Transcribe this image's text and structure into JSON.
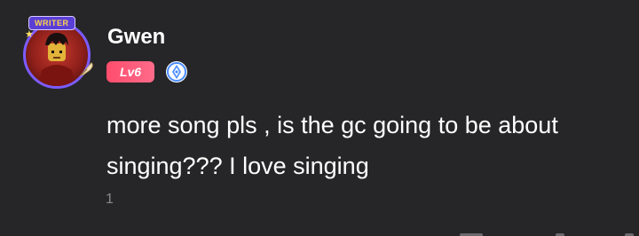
{
  "comment": {
    "avatar_frame_label": "WRITER",
    "username": "Gwen",
    "level": "Lv6",
    "message": "more song pls , is the gc going to be about singing??? I love singing",
    "like_count": "1"
  },
  "colors": {
    "background": "#262628",
    "level_badge": "#ff4d6d",
    "role_icon": "#4a8cff",
    "muted_text": "#8a8a8e"
  },
  "icons": {
    "frame_star": "star-icon",
    "frame_quill": "quill-icon",
    "role": "role-badge-icon"
  }
}
